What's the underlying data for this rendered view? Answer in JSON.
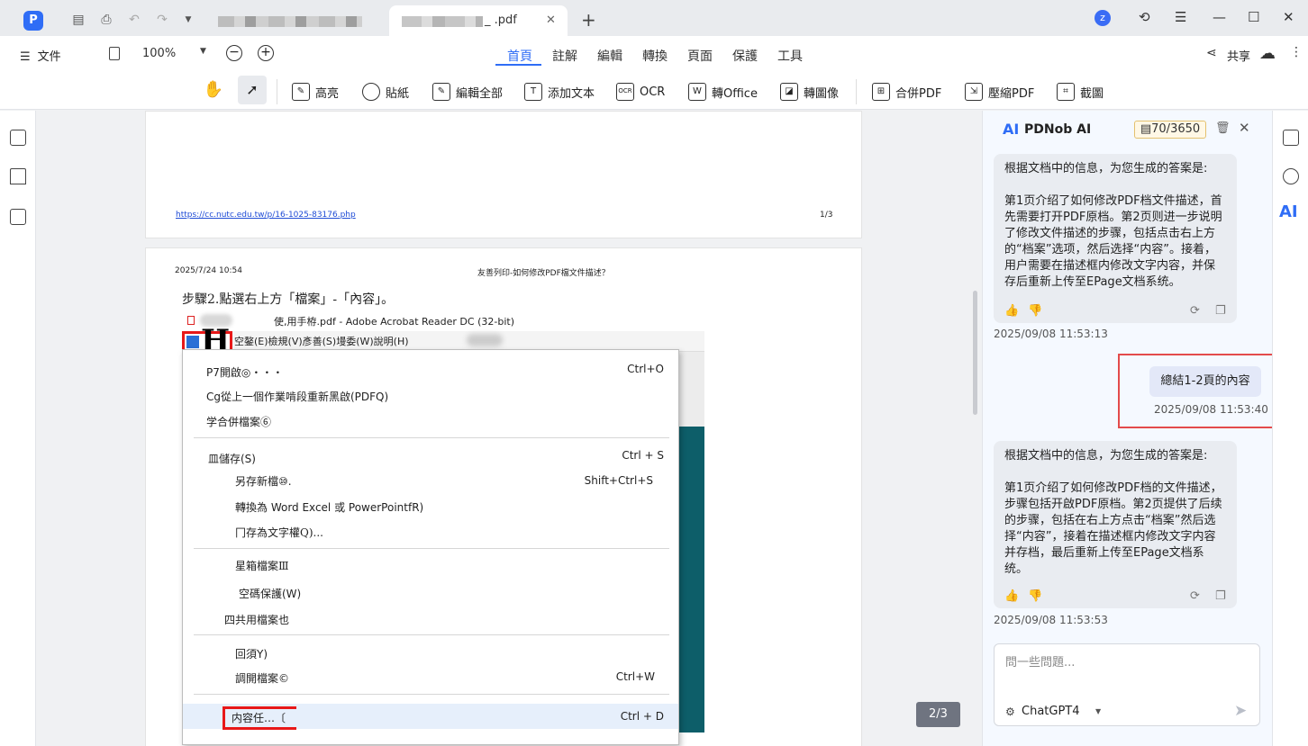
{
  "titlebar": {
    "app_logo": "P",
    "tab_active_suffix": "_ .pdf",
    "close_glyph": "✕",
    "new_tab_glyph": "+",
    "user_initial": "z",
    "icons": [
      "save-icon",
      "print-icon",
      "undo-icon",
      "redo-icon",
      "dropdown-icon",
      "history-icon",
      "menu-icon",
      "minimize-icon",
      "maximize-icon",
      "close-icon"
    ]
  },
  "menubar": {
    "file_label": "文件",
    "zoom": "100%",
    "tabs": [
      "首頁",
      "註解",
      "編輯",
      "轉換",
      "頁面",
      "保護",
      "工具"
    ],
    "active_tab": "首頁",
    "share_label": "共享"
  },
  "toolbar": {
    "tools": [
      "高亮",
      "貼紙",
      "編輯全部",
      "添加文本",
      "OCR",
      "轉Office",
      "轉圖像",
      "合併PDF",
      "壓縮PDF",
      "截圖"
    ]
  },
  "document": {
    "page1": {
      "link": "https://cc.nutc.edu.tw/p/16-1025-83176.php",
      "page_num": "1/3"
    },
    "page2": {
      "date": "2025/7/24 10:54",
      "title": "友善列印-如何修改PDF檔文件描述？",
      "step": "步驟2.點選右上方「檔案」-「內容」。",
      "shot_title": "使,用手栫.pdf - Adobe Acrobat Reader DC (32-bit)",
      "shot_menu": "空鏊(E)檢規(V)彥善(S)墁委(W)說明(H)",
      "shot_H": "H",
      "dropdown": [
        {
          "label": "P7開啟◎・・・",
          "shortcut": "Ctrl+O"
        },
        {
          "label": "Cg從上一個作業啃段重新黑啟(PDFQ)",
          "shortcut": ""
        },
        {
          "label": "学合併檔案⑥",
          "shortcut": ""
        },
        {
          "label": "皿儲存(S)",
          "shortcut": "Ctrl + S"
        },
        {
          "label": "另存新檔⑩.",
          "shortcut": "Shift+Ctrl+S"
        },
        {
          "label": "轉換為 Word Excel 或 PowerPointfR)",
          "shortcut": ""
        },
        {
          "label": "冂存為文字權Q)...",
          "shortcut": ""
        },
        {
          "label": "星箱檔案Ⅲ",
          "shortcut": ""
        },
        {
          "label": "空碼保護(W)",
          "shortcut": ""
        },
        {
          "label": "四共用檔案也",
          "shortcut": ""
        },
        {
          "label": "回須Y)",
          "shortcut": ""
        },
        {
          "label": "調開檔案©",
          "shortcut": "Ctrl+W"
        },
        {
          "label": "内容任…〔",
          "shortcut": "Ctrl + D"
        }
      ]
    },
    "page_indicator": "2/3"
  },
  "ai_panel": {
    "logo": "AI",
    "title": "PDNob AI",
    "quota": "70/3650",
    "messages": [
      {
        "role": "ai",
        "text": "根据文档中的信息，为您生成的答案是:\n\n第1页介绍了如何修改PDF档文件描述，首先需要打开PDF原档。第2页则进一步说明了修改文件描述的步骤，包括点击右上方的“档案”选项，然后选择“内容”。接着，用户需要在描述框内修改文字内容，并保存后重新上传至EPage文档系统。",
        "time": "2025/09/08 11:53:13"
      },
      {
        "role": "user",
        "text": "總結1-2頁的內容",
        "time": "2025/09/08 11:53:40"
      },
      {
        "role": "ai",
        "text": "根据文档中的信息，为您生成的答案是:\n\n第1页介绍了如何修改PDF档的文件描述，步骤包括开啟PDF原档。第2页提供了后续的步骤，包括在右上方点击“档案”然后选择“内容”，接着在描述框内修改文字内容并存档，最后重新上传至EPage文档系统。",
        "time": "2025/09/08 11:53:53"
      }
    ],
    "input_placeholder": "問一些問題...",
    "model": "ChatGPT4"
  },
  "colors": {
    "accent": "#2f6df6",
    "highlight_red": "#e34b4b",
    "panel_bg": "#f5f9ff"
  }
}
